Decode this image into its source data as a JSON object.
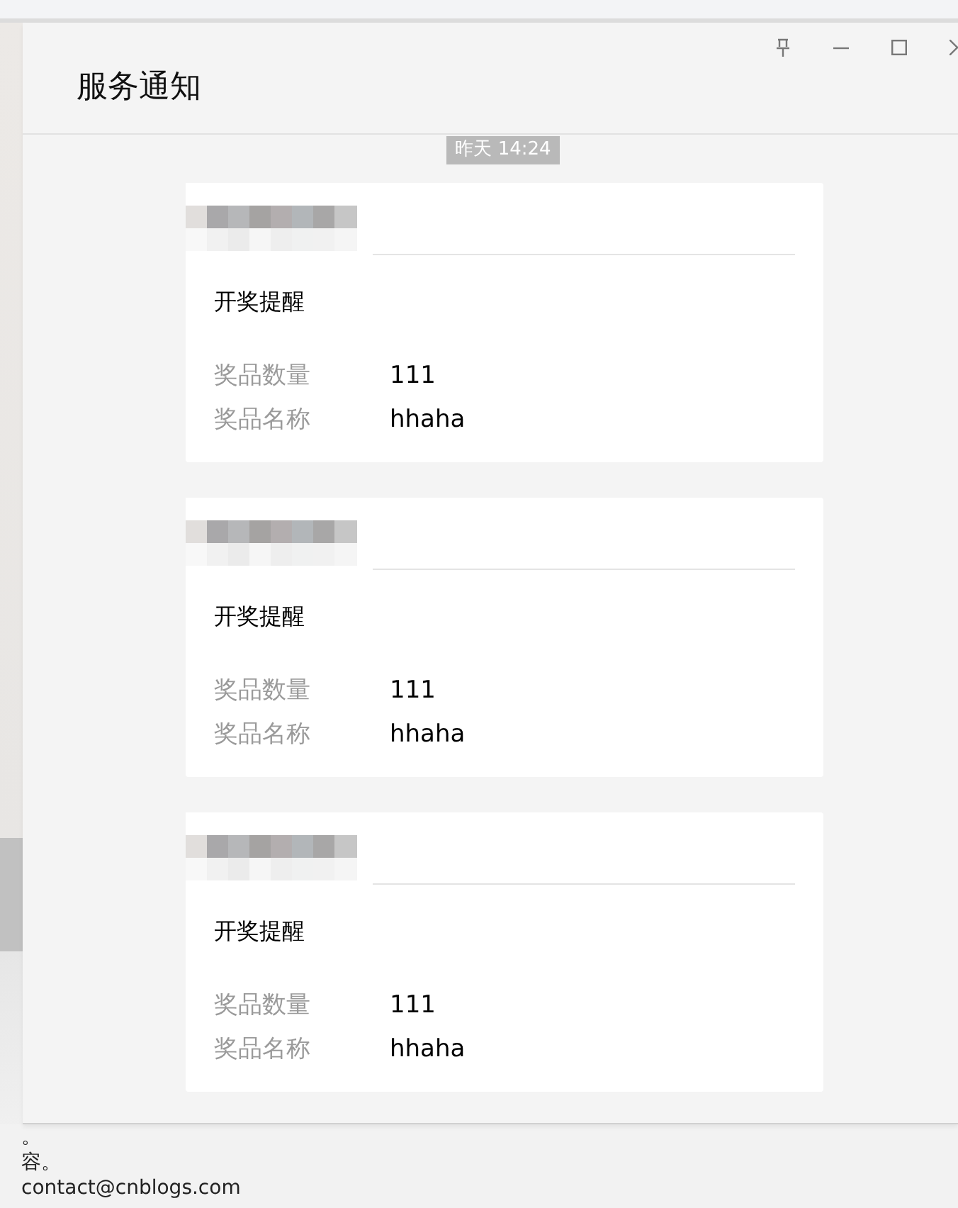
{
  "window": {
    "title": "服务通知"
  },
  "timestamp": "昨天 14:24",
  "messages": [
    {
      "title": "开奖提醒",
      "fields": [
        {
          "label": "奖品数量",
          "value": "111"
        },
        {
          "label": "奖品名称",
          "value": "hhaha"
        }
      ]
    },
    {
      "title": "开奖提醒",
      "fields": [
        {
          "label": "奖品数量",
          "value": "111"
        },
        {
          "label": "奖品名称",
          "value": "hhaha"
        }
      ]
    },
    {
      "title": "开奖提醒",
      "fields": [
        {
          "label": "奖品数量",
          "value": "111"
        },
        {
          "label": "奖品名称",
          "value": "hhaha"
        }
      ]
    }
  ],
  "background_text": [
    "。",
    "容。",
    "contact@cnblogs.com"
  ]
}
